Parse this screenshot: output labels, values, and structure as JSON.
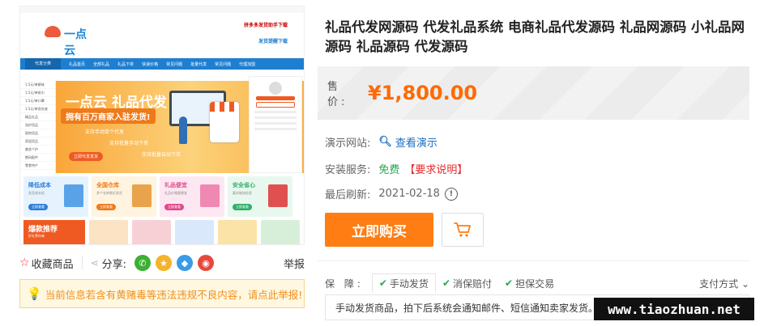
{
  "product_image": {
    "brand_name": "一点云",
    "promo_1": "拼多多发货助手下载",
    "promo_2": "发货提醒下载",
    "nav_category": "代发分类",
    "nav_items": [
      "礼品首页",
      "全部礼品",
      "礼品下单",
      "快递价格",
      "常见问题",
      "批量代发",
      "常见问题",
      "代理加盟"
    ],
    "side_items": [
      "1.5元/单裤袜",
      "1.5元/单纸巾",
      "1.5元/单口罩",
      "1.5元/单洗衣液",
      "精品礼品",
      "洗护用品",
      "厨房用品",
      "家居用品",
      "美妆个护",
      "数码配件",
      "零食特产"
    ],
    "hero_title": "一点云 礼品代发",
    "hero_sub": "拥有百万商家入驻发货!",
    "hero_line1": "支持手动单个代发",
    "hero_line2": "支持批量手动下单",
    "hero_line3": "支持批量自动下单",
    "hero_btn": "立即代发发货",
    "cards": [
      {
        "title": "降低成本",
        "sub": "发货成本低",
        "btn": "立即查看",
        "bg": "#e6f3ff",
        "btncolor": "#2d7fd6",
        "pic": "#5aa2e8"
      },
      {
        "title": "全国仓库",
        "sub": "多个仓库就近发货",
        "btn": "立即查看",
        "bg": "#fff4e0",
        "btncolor": "#ef7a1a",
        "pic": "#e9a34a"
      },
      {
        "title": "礼品便宜",
        "sub": "礼品价格超便宜",
        "btn": "立即查看",
        "bg": "#fde8f2",
        "btncolor": "#e04a8a",
        "pic": "#ef88b3"
      },
      {
        "title": "安全省心",
        "sub": "真实物流信息",
        "btn": "立即查看",
        "bg": "#e8f8ee",
        "btncolor": "#2fae6a",
        "pic": "#e05050"
      }
    ],
    "row2_title": "爆款推荐",
    "row2_sub": "好礼等你来",
    "thumbs": [
      "#fbe3c4",
      "#f7d0d6",
      "#d9e9fb",
      "#fbe3a8",
      "#d7efd9"
    ]
  },
  "share": {
    "favorite_label": "收藏商品",
    "share_label": "分享:",
    "report_label": "举报",
    "colors": {
      "wechat": "#3cb034",
      "star": "#f5b32a",
      "qq": "#3a9be8",
      "weibo": "#e8483c"
    }
  },
  "notice": "当前信息若含有黄赌毒等违法违规不良内容，请点此举报!",
  "product": {
    "title": "礼品代发网源码 代发礼品系统 电商礼品代发源码 礼品网源码 小礼品网源码 礼品源码 代发源码",
    "price_label": "售 价:",
    "price": "¥1,800.00",
    "demo_label": "演示网站:",
    "demo_link": "查看演示",
    "install_label": "安装服务:",
    "install_value": "免费",
    "install_note": "【要求说明】",
    "refresh_label": "最后刷新:",
    "refresh_date": "2021-02-18",
    "buy_label": "立即购买"
  },
  "guarantee": {
    "label": "保 障:",
    "tags": [
      "手动发货",
      "消保赔付",
      "担保交易"
    ],
    "payment": "支付方式",
    "desc": "手动发货商品，拍下后系统会通知邮件、短信通知卖家发货。"
  },
  "watermark": "www.tiaozhuan.net",
  "colors": {
    "accent": "#ff6a00",
    "buy": "#ff7d12",
    "link": "#1b6ec2",
    "green": "#23a74b"
  }
}
